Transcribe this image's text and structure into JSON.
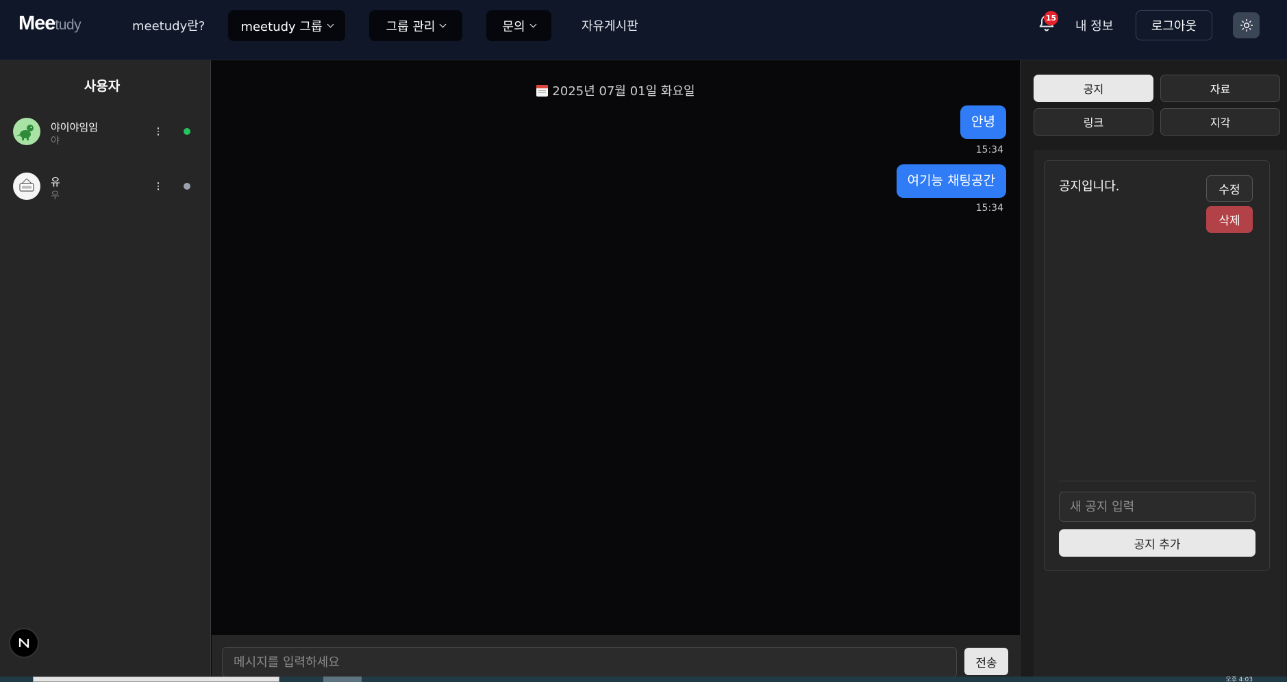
{
  "colors": {
    "navbar_bg": "#0f1729",
    "accent_blue": "#2f7cf6",
    "online": "#22c55e",
    "offline": "#9ca3af",
    "danger": "#b24248",
    "badge_red": "#e5232c"
  },
  "navbar": {
    "logo_bold": "Mee",
    "logo_light": "tudy",
    "about_link": "meetudy란?",
    "group_menu": "meetudy 그룹",
    "manage_menu": "그룹 관리",
    "inquiry_menu": "문의",
    "board_link": "자유게시판",
    "notification_count": "15",
    "my_info": "내 정보",
    "logout": "로그아웃",
    "icons": [
      "bell-icon",
      "sun-icon",
      "chevron-down-icon"
    ]
  },
  "sidebar": {
    "title": "사용자",
    "users": [
      {
        "name": "야이야임임",
        "sub": "야",
        "status": "online"
      },
      {
        "name": "유",
        "sub": "우",
        "status": "offline"
      }
    ],
    "badge_letter": "N"
  },
  "chat": {
    "date": "2025년 07월 01일 화요일",
    "messages": [
      {
        "text": "안녕",
        "time": "15:34",
        "mine": true
      },
      {
        "text": "여기능 채팅공간",
        "time": "15:34",
        "mine": true
      }
    ],
    "input_placeholder": "메시지를 입력하세요",
    "send_label": "전송"
  },
  "right_panel": {
    "tabs": [
      {
        "label": "공지",
        "active": true
      },
      {
        "label": "자료",
        "active": false
      },
      {
        "label": "링크",
        "active": false
      },
      {
        "label": "지각",
        "active": false
      }
    ],
    "notice": {
      "text": "공지입니다.",
      "edit_label": "수정",
      "delete_label": "삭제"
    },
    "new_notice_placeholder": "새 공지 입력",
    "add_label": "공지 추가"
  },
  "taskbar": {
    "clock": "오후 4:03"
  }
}
